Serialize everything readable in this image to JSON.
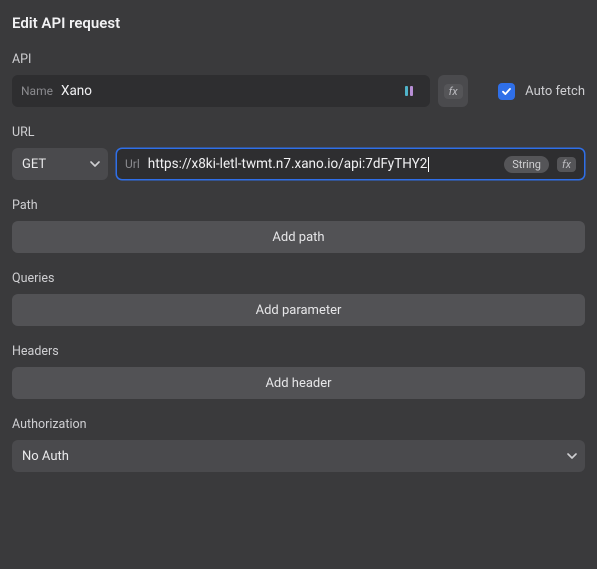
{
  "title": "Edit API request",
  "sections": {
    "api": "API",
    "url": "URL",
    "path": "Path",
    "queries": "Queries",
    "headers": "Headers",
    "authorization": "Authorization"
  },
  "api": {
    "name_prefix": "Name",
    "name_value": "Xano",
    "auto_fetch_label": "Auto fetch",
    "auto_fetch_checked": true
  },
  "url": {
    "method": "GET",
    "url_prefix": "Url",
    "url_value": "https://x8ki-letl-twmt.n7.xano.io/api:7dFyTHY2",
    "type_chip": "String"
  },
  "buttons": {
    "add_path": "Add path",
    "add_parameter": "Add parameter",
    "add_header": "Add header"
  },
  "authorization": {
    "selected": "No Auth"
  },
  "icons": {
    "binding": "binding-icon",
    "fx": "fx",
    "chevron": "chevron-down"
  }
}
